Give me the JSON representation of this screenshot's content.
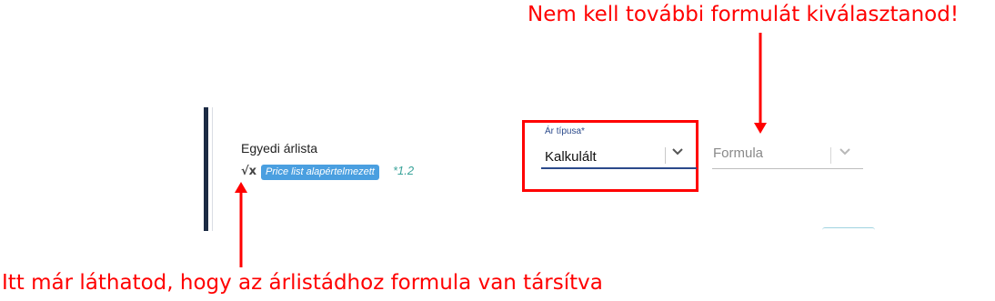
{
  "pricelist": {
    "name": "Egyedi árlista",
    "formula_icon": "√x",
    "formula_badge": "Price list alapértelmezett",
    "multiplier": "*1.2"
  },
  "price_type": {
    "label": "Ár típusa",
    "required_mark": "*",
    "value": "Kalkulált"
  },
  "formula_select": {
    "placeholder": "Formula"
  },
  "annotations": {
    "top": "Nem kell további formulát kiválasztanod!",
    "bottom": "Itt már láthatod, hogy az árlistádhoz formula van társítva"
  },
  "colors": {
    "annotation_red": "#ff0000",
    "badge_blue": "#4a9fe0",
    "accent_navy": "#1c2b44",
    "multiplier_teal": "#3aa39a"
  },
  "icons": [
    "formula-icon",
    "chevron-down-icon"
  ]
}
